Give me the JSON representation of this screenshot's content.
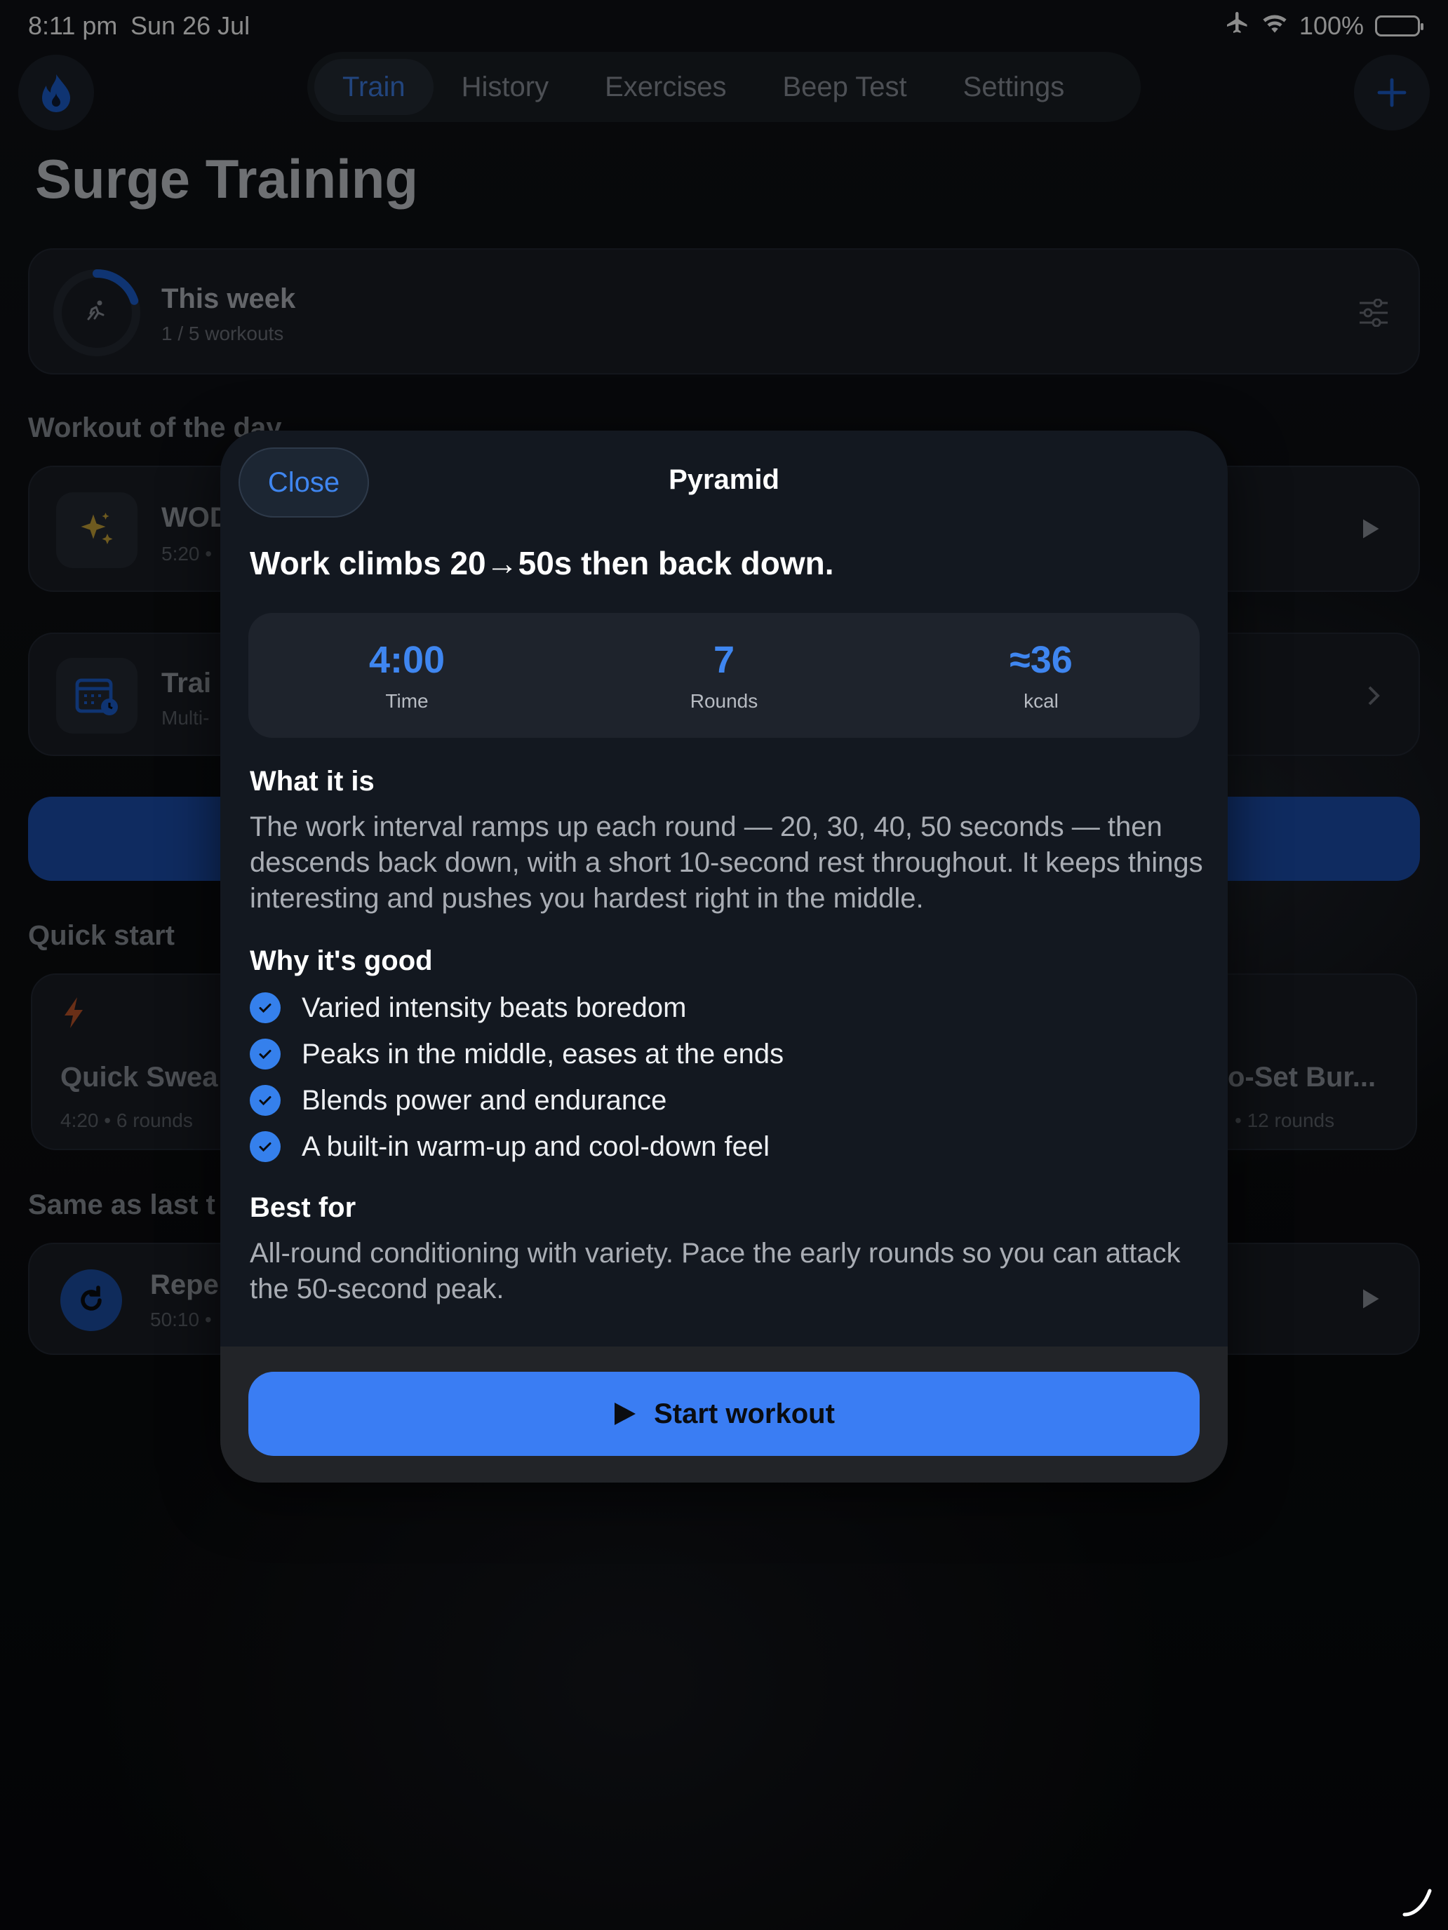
{
  "status": {
    "time": "8:11 pm",
    "date": "Sun 26 Jul",
    "battery": "100%"
  },
  "nav": {
    "tabs": [
      {
        "label": "Train",
        "active": true
      },
      {
        "label": "History"
      },
      {
        "label": "Exercises"
      },
      {
        "label": "Beep Test"
      },
      {
        "label": "Settings"
      }
    ]
  },
  "page": {
    "title": "Surge Training"
  },
  "week": {
    "title": "This week",
    "sub": "1 / 5 workouts",
    "progress": 0.2
  },
  "sections": {
    "wod": "Workout of the day",
    "quick_start": "Quick start",
    "same_as_last": "Same as last t"
  },
  "wod": {
    "title": "WOD",
    "sub": "5:20 •"
  },
  "plan": {
    "title": "Trai",
    "sub": "Multi-"
  },
  "quick_start": [
    {
      "title": "Quick Swea",
      "sub": "4:20 • 6 rounds"
    },
    {
      "title": "o-Set Bur...",
      "sub": "• 12 rounds"
    }
  ],
  "repeat": {
    "title": "Repe",
    "sub": "50:10 •"
  },
  "modal": {
    "close": "Close",
    "title": "Pyramid",
    "headline": "Work climbs 20→50s then back down.",
    "stats": [
      {
        "value": "4:00",
        "label": "Time"
      },
      {
        "value": "7",
        "label": "Rounds"
      },
      {
        "value": "≈36",
        "label": "kcal"
      }
    ],
    "what_heading": "What it is",
    "what_text": "The work interval ramps up each round — 20, 30, 40, 50 seconds — then descends back down, with a short 10-second rest throughout. It keeps things interesting and pushes you hardest right in the middle.",
    "why_heading": "Why it's good",
    "why_items": [
      "Varied intensity beats boredom",
      "Peaks in the middle, eases at the ends",
      "Blends power and endurance",
      "A built-in warm-up and cool-down feel"
    ],
    "best_heading": "Best for",
    "best_text": "All-round conditioning with variety. Pace the early rounds so you can attack the 50-second peak.",
    "start": "Start workout"
  },
  "colors": {
    "accent": "#3a7df3",
    "background": "#0a0c10",
    "modal": "#131820"
  }
}
